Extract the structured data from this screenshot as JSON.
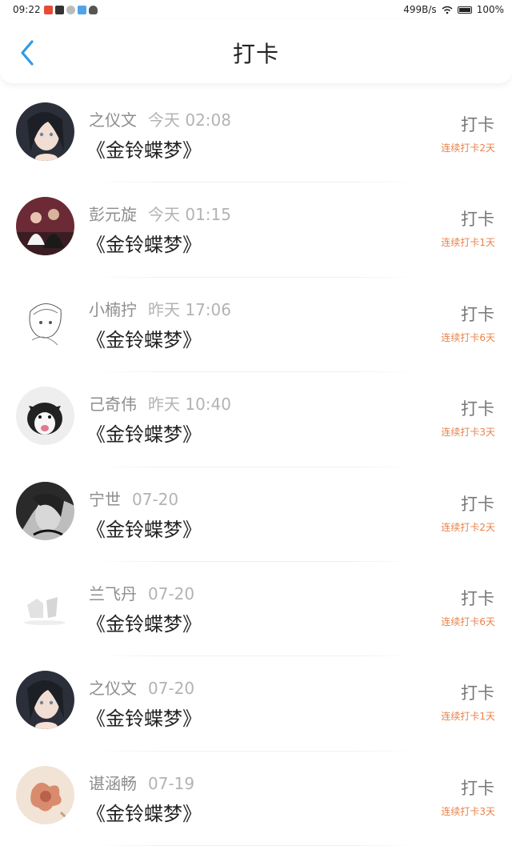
{
  "status_bar": {
    "time": "09:22",
    "net_speed": "499B/s",
    "battery": "100%"
  },
  "header": {
    "title": "打卡"
  },
  "items": [
    {
      "name": "之仪文",
      "time": "今天 02:08",
      "book": "《金铃蝶梦》",
      "action": "打卡",
      "streak": "连续打卡2天"
    },
    {
      "name": "彭元旋",
      "time": "今天 01:15",
      "book": "《金铃蝶梦》",
      "action": "打卡",
      "streak": "连续打卡1天"
    },
    {
      "name": "小楠拧",
      "time": "昨天 17:06",
      "book": "《金铃蝶梦》",
      "action": "打卡",
      "streak": "连续打卡6天"
    },
    {
      "name": "己奇伟",
      "time": "昨天 10:40",
      "book": "《金铃蝶梦》",
      "action": "打卡",
      "streak": "连续打卡3天"
    },
    {
      "name": "宁世",
      "time": "07-20",
      "book": "《金铃蝶梦》",
      "action": "打卡",
      "streak": "连续打卡2天"
    },
    {
      "name": "兰飞丹",
      "time": "07-20",
      "book": "《金铃蝶梦》",
      "action": "打卡",
      "streak": "连续打卡6天"
    },
    {
      "name": "之仪文",
      "time": "07-20",
      "book": "《金铃蝶梦》",
      "action": "打卡",
      "streak": "连续打卡1天"
    },
    {
      "name": "谌涵畅",
      "time": "07-19",
      "book": "《金铃蝶梦》",
      "action": "打卡",
      "streak": "连续打卡3天"
    }
  ],
  "colors": {
    "accent": "#2e9be6",
    "streak": "#e8824a"
  }
}
